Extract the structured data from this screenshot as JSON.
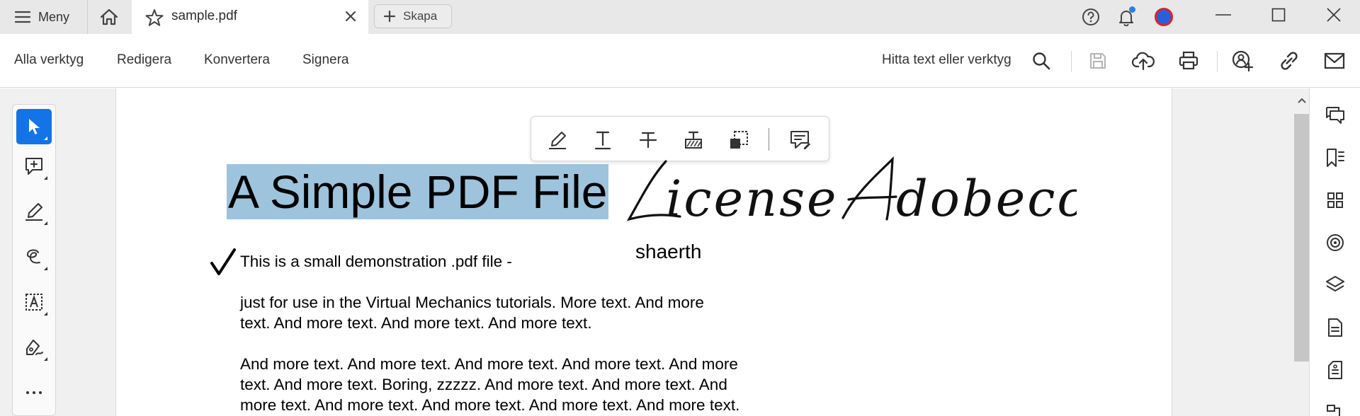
{
  "titlebar": {
    "menu_label": "Meny",
    "tab_title": "sample.pdf",
    "new_tab_label": "Skapa"
  },
  "toolbar": {
    "menus": [
      "Alla verktyg",
      "Redigera",
      "Konvertera",
      "Signera"
    ],
    "find_label": "Hitta text eller verktyg"
  },
  "document": {
    "title": "A Simple PDF File",
    "signature_text": "License Adobeccl",
    "signature_name": "shaerth",
    "lines": [
      "This is a small demonstration .pdf file -",
      "just for use in the Virtual Mechanics tutorials. More text. And more",
      "text. And more text. And more text. And more text.",
      "And more text. And more text. And more text. And more text. And more",
      "text. And more text. Boring, zzzzz. And more text. And more text. And",
      "more text. And more text. And more text. And more text. And more text."
    ]
  },
  "colors": {
    "accent": "#1473e6",
    "selection": "#9ec3dc",
    "notification_dot": "#2680eb"
  }
}
